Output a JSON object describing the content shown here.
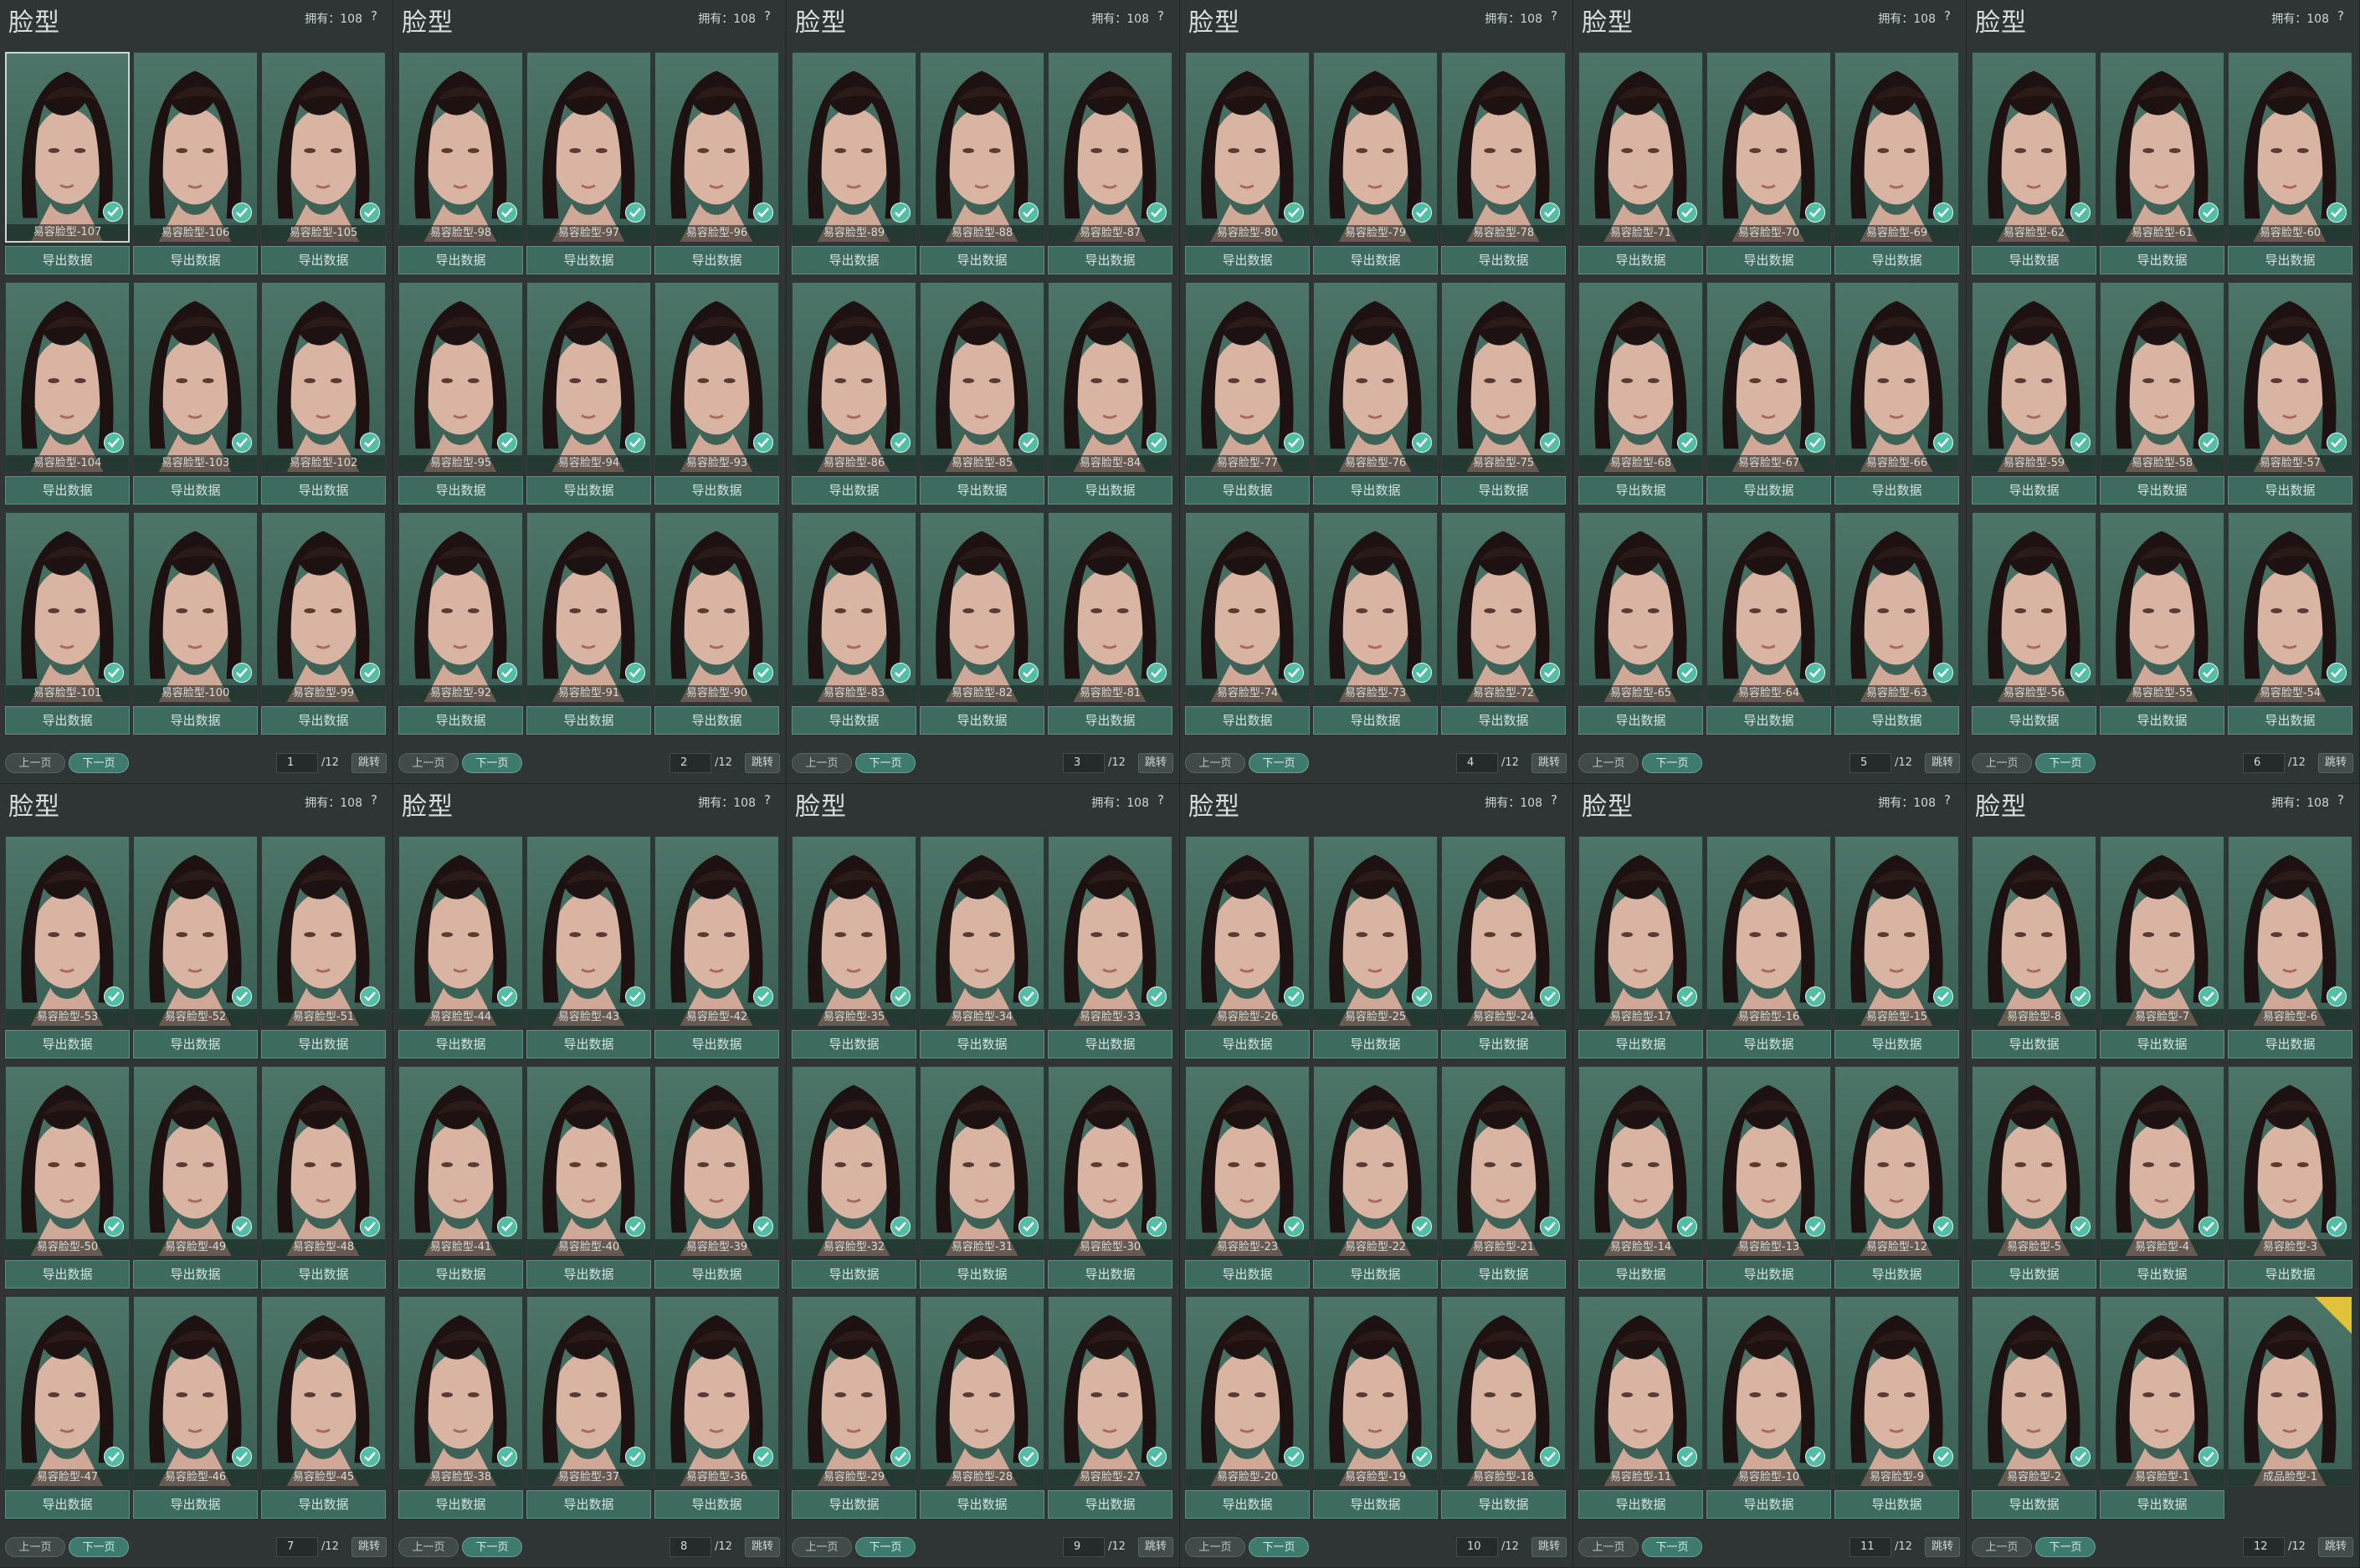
{
  "panels": [
    {
      "title": "脸型",
      "owned": "拥有：108",
      "help": "?",
      "page": "1",
      "total": "/12",
      "prev": "上一页",
      "next": "下一页",
      "jump": "跳转",
      "cards": [
        {
          "label": "易容脸型-107",
          "export": "导出数据",
          "selected": true
        },
        {
          "label": "易容脸型-106",
          "export": "导出数据"
        },
        {
          "label": "易容脸型-105",
          "export": "导出数据"
        },
        {
          "label": "易容脸型-104",
          "export": "导出数据"
        },
        {
          "label": "易容脸型-103",
          "export": "导出数据"
        },
        {
          "label": "易容脸型-102",
          "export": "导出数据"
        },
        {
          "label": "易容脸型-101",
          "export": "导出数据"
        },
        {
          "label": "易容脸型-100",
          "export": "导出数据"
        },
        {
          "label": "易容脸型-99",
          "export": "导出数据"
        }
      ]
    },
    {
      "title": "脸型",
      "owned": "拥有：108",
      "help": "?",
      "page": "2",
      "total": "/12",
      "prev": "上一页",
      "next": "下一页",
      "jump": "跳转",
      "cards": [
        {
          "label": "易容脸型-98",
          "export": "导出数据"
        },
        {
          "label": "易容脸型-97",
          "export": "导出数据"
        },
        {
          "label": "易容脸型-96",
          "export": "导出数据"
        },
        {
          "label": "易容脸型-95",
          "export": "导出数据"
        },
        {
          "label": "易容脸型-94",
          "export": "导出数据"
        },
        {
          "label": "易容脸型-93",
          "export": "导出数据"
        },
        {
          "label": "易容脸型-92",
          "export": "导出数据"
        },
        {
          "label": "易容脸型-91",
          "export": "导出数据"
        },
        {
          "label": "易容脸型-90",
          "export": "导出数据"
        }
      ]
    },
    {
      "title": "脸型",
      "owned": "拥有：108",
      "help": "?",
      "page": "3",
      "total": "/12",
      "prev": "上一页",
      "next": "下一页",
      "jump": "跳转",
      "cards": [
        {
          "label": "易容脸型-89",
          "export": "导出数据"
        },
        {
          "label": "易容脸型-88",
          "export": "导出数据"
        },
        {
          "label": "易容脸型-87",
          "export": "导出数据"
        },
        {
          "label": "易容脸型-86",
          "export": "导出数据"
        },
        {
          "label": "易容脸型-85",
          "export": "导出数据"
        },
        {
          "label": "易容脸型-84",
          "export": "导出数据"
        },
        {
          "label": "易容脸型-83",
          "export": "导出数据"
        },
        {
          "label": "易容脸型-82",
          "export": "导出数据"
        },
        {
          "label": "易容脸型-81",
          "export": "导出数据"
        }
      ]
    },
    {
      "title": "脸型",
      "owned": "拥有：108",
      "help": "?",
      "page": "4",
      "total": "/12",
      "prev": "上一页",
      "next": "下一页",
      "jump": "跳转",
      "cards": [
        {
          "label": "易容脸型-80",
          "export": "导出数据"
        },
        {
          "label": "易容脸型-79",
          "export": "导出数据"
        },
        {
          "label": "易容脸型-78",
          "export": "导出数据"
        },
        {
          "label": "易容脸型-77",
          "export": "导出数据"
        },
        {
          "label": "易容脸型-76",
          "export": "导出数据"
        },
        {
          "label": "易容脸型-75",
          "export": "导出数据"
        },
        {
          "label": "易容脸型-74",
          "export": "导出数据"
        },
        {
          "label": "易容脸型-73",
          "export": "导出数据"
        },
        {
          "label": "易容脸型-72",
          "export": "导出数据"
        }
      ]
    },
    {
      "title": "脸型",
      "owned": "拥有：108",
      "help": "?",
      "page": "5",
      "total": "/12",
      "prev": "上一页",
      "next": "下一页",
      "jump": "跳转",
      "cards": [
        {
          "label": "易容脸型-71",
          "export": "导出数据"
        },
        {
          "label": "易容脸型-70",
          "export": "导出数据"
        },
        {
          "label": "易容脸型-69",
          "export": "导出数据"
        },
        {
          "label": "易容脸型-68",
          "export": "导出数据"
        },
        {
          "label": "易容脸型-67",
          "export": "导出数据"
        },
        {
          "label": "易容脸型-66",
          "export": "导出数据"
        },
        {
          "label": "易容脸型-65",
          "export": "导出数据"
        },
        {
          "label": "易容脸型-64",
          "export": "导出数据"
        },
        {
          "label": "易容脸型-63",
          "export": "导出数据"
        }
      ]
    },
    {
      "title": "脸型",
      "owned": "拥有：108",
      "help": "?",
      "page": "6",
      "total": "/12",
      "prev": "上一页",
      "next": "下一页",
      "jump": "跳转",
      "cards": [
        {
          "label": "易容脸型-62",
          "export": "导出数据"
        },
        {
          "label": "易容脸型-61",
          "export": "导出数据"
        },
        {
          "label": "易容脸型-60",
          "export": "导出数据"
        },
        {
          "label": "易容脸型-59",
          "export": "导出数据"
        },
        {
          "label": "易容脸型-58",
          "export": "导出数据"
        },
        {
          "label": "易容脸型-57",
          "export": "导出数据"
        },
        {
          "label": "易容脸型-56",
          "export": "导出数据"
        },
        {
          "label": "易容脸型-55",
          "export": "导出数据"
        },
        {
          "label": "易容脸型-54",
          "export": "导出数据"
        }
      ]
    },
    {
      "title": "脸型",
      "owned": "拥有：108",
      "help": "?",
      "page": "7",
      "total": "/12",
      "prev": "上一页",
      "next": "下一页",
      "jump": "跳转",
      "cards": [
        {
          "label": "易容脸型-53",
          "export": "导出数据"
        },
        {
          "label": "易容脸型-52",
          "export": "导出数据"
        },
        {
          "label": "易容脸型-51",
          "export": "导出数据"
        },
        {
          "label": "易容脸型-50",
          "export": "导出数据"
        },
        {
          "label": "易容脸型-49",
          "export": "导出数据"
        },
        {
          "label": "易容脸型-48",
          "export": "导出数据"
        },
        {
          "label": "易容脸型-47",
          "export": "导出数据"
        },
        {
          "label": "易容脸型-46",
          "export": "导出数据"
        },
        {
          "label": "易容脸型-45",
          "export": "导出数据"
        }
      ]
    },
    {
      "title": "脸型",
      "owned": "拥有：108",
      "help": "?",
      "page": "8",
      "total": "/12",
      "prev": "上一页",
      "next": "下一页",
      "jump": "跳转",
      "cards": [
        {
          "label": "易容脸型-44",
          "export": "导出数据"
        },
        {
          "label": "易容脸型-43",
          "export": "导出数据"
        },
        {
          "label": "易容脸型-42",
          "export": "导出数据"
        },
        {
          "label": "易容脸型-41",
          "export": "导出数据"
        },
        {
          "label": "易容脸型-40",
          "export": "导出数据"
        },
        {
          "label": "易容脸型-39",
          "export": "导出数据"
        },
        {
          "label": "易容脸型-38",
          "export": "导出数据"
        },
        {
          "label": "易容脸型-37",
          "export": "导出数据"
        },
        {
          "label": "易容脸型-36",
          "export": "导出数据"
        }
      ]
    },
    {
      "title": "脸型",
      "owned": "拥有：108",
      "help": "?",
      "page": "9",
      "total": "/12",
      "prev": "上一页",
      "next": "下一页",
      "jump": "跳转",
      "cards": [
        {
          "label": "易容脸型-35",
          "export": "导出数据"
        },
        {
          "label": "易容脸型-34",
          "export": "导出数据"
        },
        {
          "label": "易容脸型-33",
          "export": "导出数据"
        },
        {
          "label": "易容脸型-32",
          "export": "导出数据"
        },
        {
          "label": "易容脸型-31",
          "export": "导出数据"
        },
        {
          "label": "易容脸型-30",
          "export": "导出数据"
        },
        {
          "label": "易容脸型-29",
          "export": "导出数据"
        },
        {
          "label": "易容脸型-28",
          "export": "导出数据"
        },
        {
          "label": "易容脸型-27",
          "export": "导出数据"
        }
      ]
    },
    {
      "title": "脸型",
      "owned": "拥有：108",
      "help": "?",
      "page": "10",
      "total": "/12",
      "prev": "上一页",
      "next": "下一页",
      "jump": "跳转",
      "cards": [
        {
          "label": "易容脸型-26",
          "export": "导出数据"
        },
        {
          "label": "易容脸型-25",
          "export": "导出数据"
        },
        {
          "label": "易容脸型-24",
          "export": "导出数据"
        },
        {
          "label": "易容脸型-23",
          "export": "导出数据"
        },
        {
          "label": "易容脸型-22",
          "export": "导出数据"
        },
        {
          "label": "易容脸型-21",
          "export": "导出数据"
        },
        {
          "label": "易容脸型-20",
          "export": "导出数据"
        },
        {
          "label": "易容脸型-19",
          "export": "导出数据"
        },
        {
          "label": "易容脸型-18",
          "export": "导出数据"
        }
      ]
    },
    {
      "title": "脸型",
      "owned": "拥有：108",
      "help": "?",
      "page": "11",
      "total": "/12",
      "prev": "上一页",
      "next": "下一页",
      "jump": "跳转",
      "cards": [
        {
          "label": "易容脸型-17",
          "export": "导出数据"
        },
        {
          "label": "易容脸型-16",
          "export": "导出数据"
        },
        {
          "label": "易容脸型-15",
          "export": "导出数据"
        },
        {
          "label": "易容脸型-14",
          "export": "导出数据"
        },
        {
          "label": "易容脸型-13",
          "export": "导出数据"
        },
        {
          "label": "易容脸型-12",
          "export": "导出数据"
        },
        {
          "label": "易容脸型-11",
          "export": "导出数据"
        },
        {
          "label": "易容脸型-10",
          "export": "导出数据"
        },
        {
          "label": "易容脸型-9",
          "export": "导出数据"
        }
      ]
    },
    {
      "title": "脸型",
      "owned": "拥有：108",
      "help": "?",
      "page": "12",
      "total": "/12",
      "prev": "上一页",
      "next": "下一页",
      "jump": "跳转",
      "cards": [
        {
          "label": "易容脸型-8",
          "export": "导出数据"
        },
        {
          "label": "易容脸型-7",
          "export": "导出数据"
        },
        {
          "label": "易容脸型-6",
          "export": "导出数据"
        },
        {
          "label": "易容脸型-5",
          "export": "导出数据"
        },
        {
          "label": "易容脸型-4",
          "export": "导出数据"
        },
        {
          "label": "易容脸型-3",
          "export": "导出数据"
        },
        {
          "label": "易容脸型-2",
          "export": "导出数据"
        },
        {
          "label": "易容脸型-1",
          "export": "导出数据"
        },
        {
          "label": "成品脸型-1",
          "export": null,
          "nocheck": true,
          "newBadge": true
        }
      ]
    }
  ]
}
